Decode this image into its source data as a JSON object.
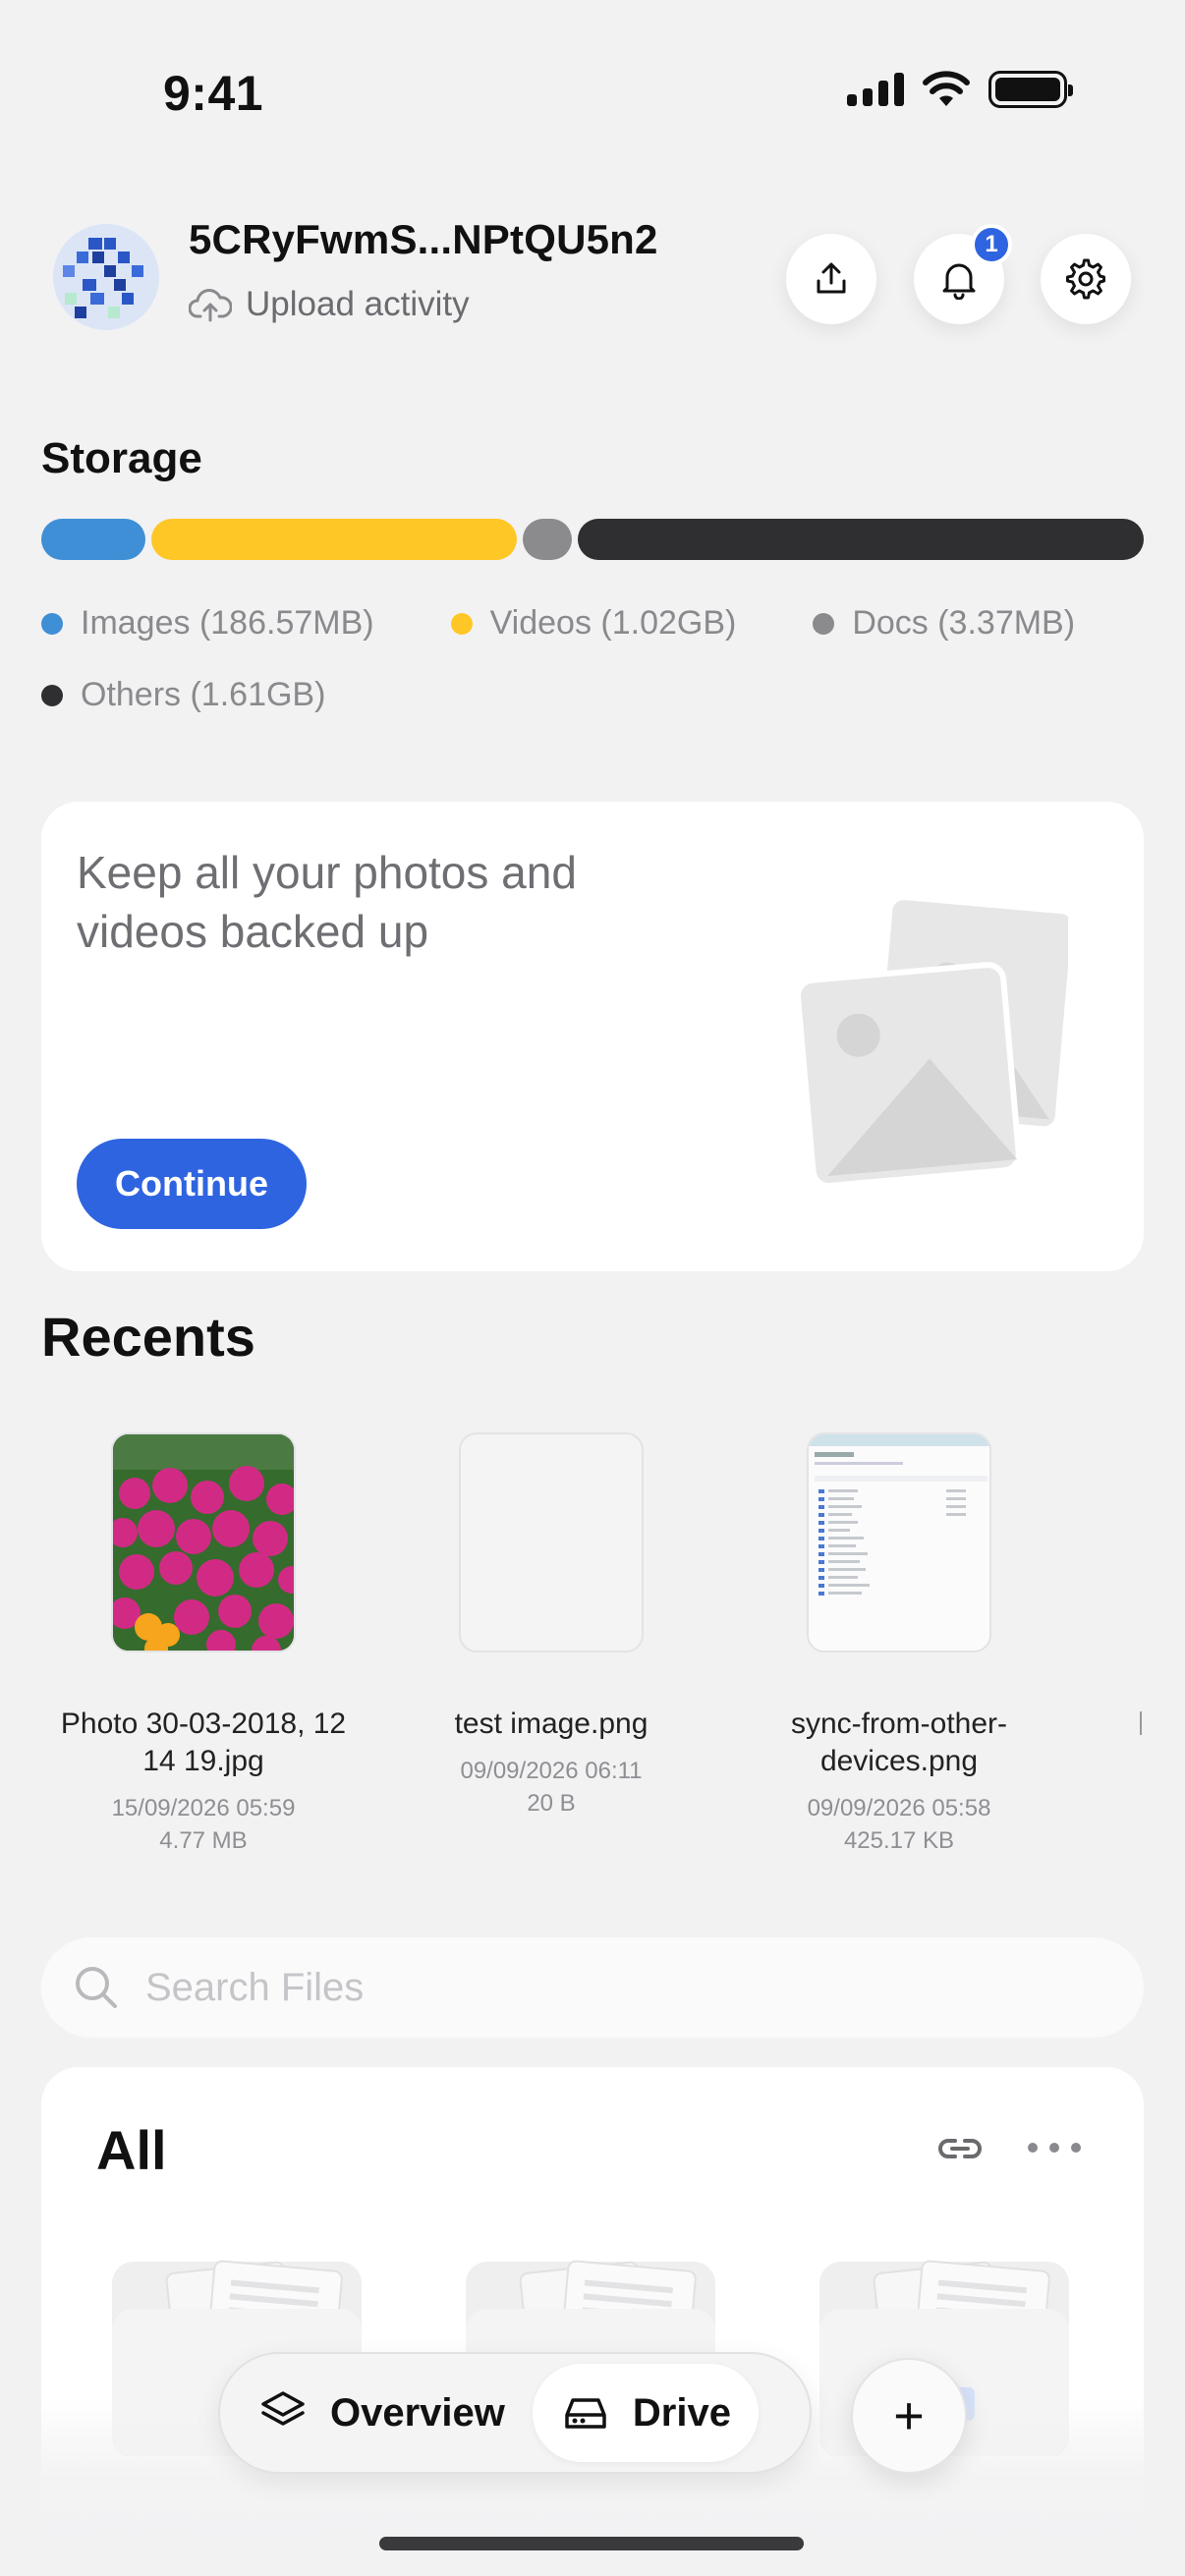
{
  "status_bar": {
    "time": "9:41",
    "icons": [
      "signal-icon",
      "wifi-icon",
      "battery-icon"
    ]
  },
  "header": {
    "account_id": "5CRyFwmS...NPtQU5n2",
    "subtitle": "Upload activity",
    "notification_count": "1",
    "buttons": [
      "upload-icon",
      "bell-icon",
      "gear-icon"
    ]
  },
  "storage": {
    "title": "Storage",
    "segments": [
      {
        "label": "Images (186.57MB)",
        "color": "#3f8fd6",
        "share": 0.096
      },
      {
        "label": "Videos (1.02GB)",
        "color": "#ffc726",
        "share": 0.337
      },
      {
        "label": "Docs (3.37MB)",
        "color": "#8b8b8d",
        "share": 0.045
      },
      {
        "label": "Others (1.61GB)",
        "color": "#2f2f31",
        "share": 0.522
      }
    ]
  },
  "backup": {
    "text": "Keep all your photos and videos backed up",
    "button": "Continue"
  },
  "recents": {
    "title": "Recents",
    "items": [
      {
        "name": "Photo 30-03-2018, 12 14 19.jpg",
        "date": "15/09/2026 05:59",
        "size": "4.77 MB"
      },
      {
        "name": "test image.png",
        "date": "09/09/2026 06:11",
        "size": "20 B"
      },
      {
        "name": "sync-from-other-devices.png",
        "date": "09/09/2026 05:58",
        "size": "425.17 KB"
      }
    ]
  },
  "search": {
    "placeholder": "Search Files"
  },
  "all": {
    "title": "All"
  },
  "nav": {
    "overview": "Overview",
    "drive": "Drive",
    "fab": "+"
  },
  "colors": {
    "accent": "#2f64e0",
    "background": "#f2f2f3"
  }
}
